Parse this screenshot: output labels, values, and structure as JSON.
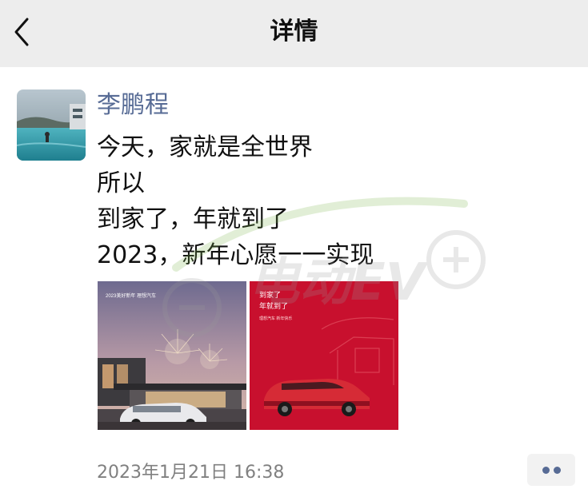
{
  "header": {
    "title": "详情",
    "back_icon": "chevron-left-icon"
  },
  "post": {
    "author": "李鹏程",
    "lines": [
      "今天，家就是全世界",
      "所以",
      "到家了，年就到了",
      "2023，新年心愿一一实现"
    ],
    "photos": [
      {
        "caption_line1": "2023美好新年 理想汽车",
        "caption_line2": ""
      },
      {
        "caption_line1": "到家了",
        "caption_line2": "年就到了",
        "caption_line3": "理想汽车 新年快乐"
      }
    ],
    "timestamp": "2023年1月21日 16:38"
  },
  "more": {
    "icon": "more-dots-icon"
  },
  "watermark": {
    "text": "电动EV"
  },
  "colors": {
    "topbar": "#ededed",
    "author": "#576b95",
    "timestamp": "#808080",
    "photo2_bg": "#c8102e"
  }
}
